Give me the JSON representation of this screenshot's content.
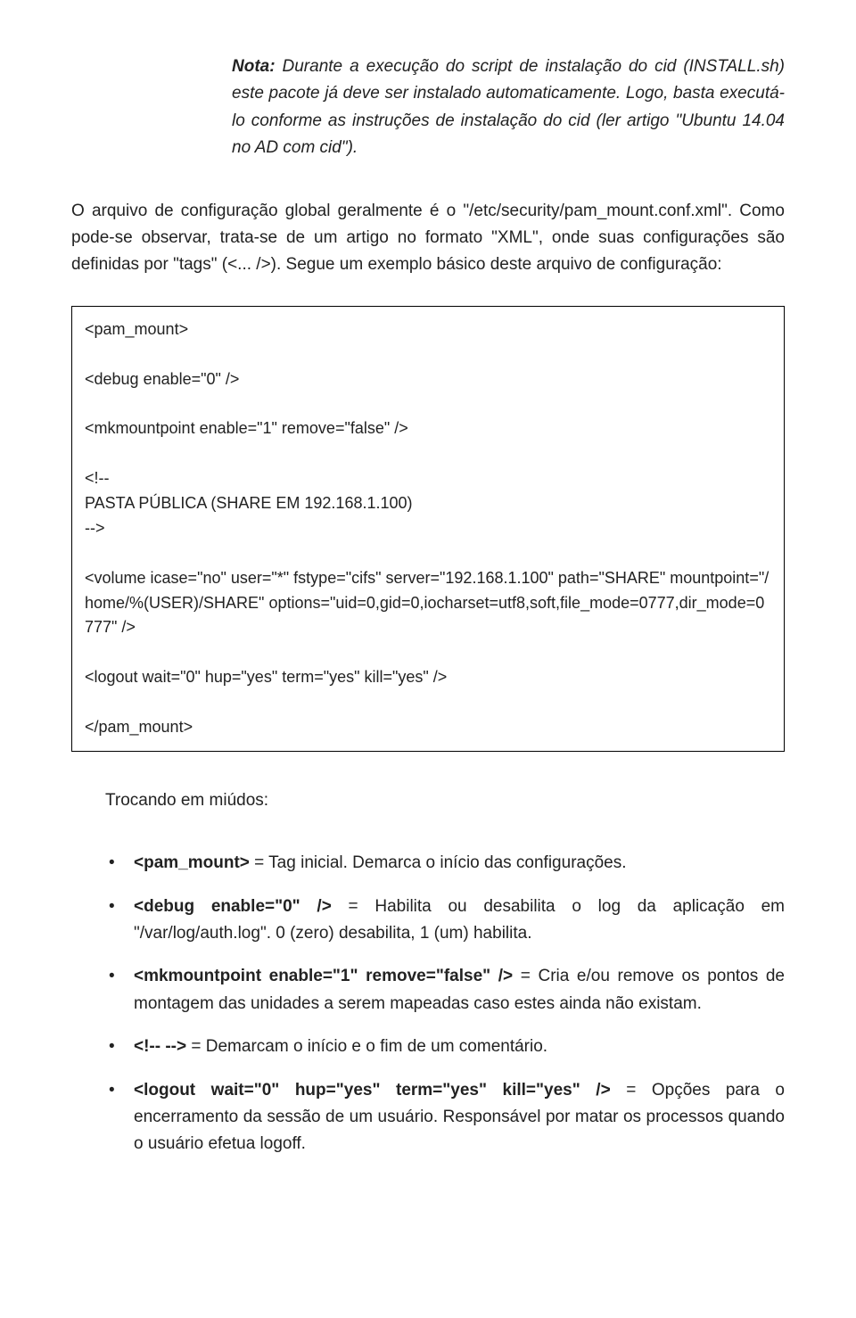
{
  "note": {
    "label": "Nota:",
    "text": " Durante a execução do script de instalação do cid (INSTALL.sh) este pacote já deve ser instalado automaticamente. Logo, basta executá-lo conforme as instruções de instalação do cid (ler artigo \"Ubuntu 14.04 no AD com cid\")."
  },
  "para1": "O arquivo de configuração global geralmente é o \"/etc/security/pam_mount.conf.xml\". Como pode-se observar, trata-se de um artigo no formato \"XML\", onde suas configurações são definidas por \"tags\" (<... />). Segue um exemplo básico deste arquivo de configuração:",
  "code": "<pam_mount>\n\n<debug enable=\"0\" />\n\n<mkmountpoint enable=\"1\" remove=\"false\" />\n\n<!--\nPASTA PÚBLICA (SHARE EM 192.168.1.100)\n-->\n\n<volume icase=\"no\" user=\"*\" fstype=\"cifs\" server=\"192.168.1.100\" path=\"SHARE\" mountpoint=\"/home/%(USER)/SHARE\" options=\"uid=0,gid=0,iocharset=utf8,soft,file_mode=0777,dir_mode=0777\" />\n\n<logout wait=\"0\" hup=\"yes\" term=\"yes\" kill=\"yes\" />\n\n</pam_mount>",
  "sectionTitle": "Trocando em miúdos:",
  "bullets": [
    {
      "bold": "<pam_mount>",
      "rest": " = Tag inicial. Demarca o início das configurações."
    },
    {
      "bold": "<debug enable=\"0\" />",
      "rest": " = Habilita ou desabilita o log da aplicação em \"/var/log/auth.log\". 0 (zero) desabilita, 1 (um) habilita."
    },
    {
      "bold": "<mkmountpoint enable=\"1\" remove=\"false\" />",
      "rest": " = Cria e/ou remove os pontos de montagem das unidades a serem mapeadas caso estes ainda não existam."
    },
    {
      "bold": "<!-- -->",
      "rest": " = Demarcam o início e o fim de um comentário."
    },
    {
      "bold": "<logout wait=\"0\" hup=\"yes\" term=\"yes\" kill=\"yes\" />",
      "rest": " = Opções para o encerramento da sessão de um usuário. Responsável por matar os processos quando o usuário efetua logoff."
    }
  ]
}
